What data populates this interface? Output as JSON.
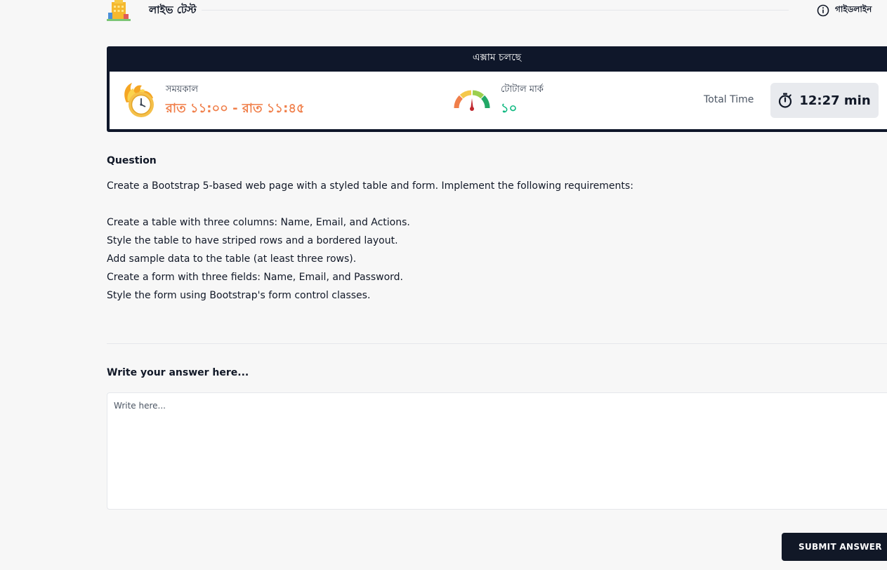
{
  "header": {
    "title": "লাইভ টেস্ট",
    "guideline_label": "গাইডলাইন",
    "logo_icon": "building-icon",
    "info_icon": "info-icon"
  },
  "exam": {
    "status": "এক্সাম চলছে",
    "duration_label": "সময়কাল",
    "duration_value": "রাত ১১:০০ - রাত ১১:৪৫",
    "marks_label": "টোটাল মার্ক",
    "marks_value": "১০",
    "total_time_label": "Total Time",
    "timer_value": "12:27 min",
    "colors": {
      "accent_orange": "#f07f4a",
      "accent_green": "#10b981",
      "dark": "#0f172a"
    }
  },
  "question": {
    "title": "Question",
    "lines": [
      "Create a Bootstrap 5-based web page with a styled table and form. Implement the following requirements:",
      "",
      "Create a table with three columns: Name, Email, and Actions.",
      "Style the table to have striped rows and a bordered layout.",
      "Add sample data to the table (at least three rows).",
      "Create a form with three fields: Name, Email, and Password.",
      "Style the form using Bootstrap's form control classes."
    ]
  },
  "answer": {
    "label": "Write your answer here...",
    "placeholder": "Write here...",
    "value": ""
  },
  "submit": {
    "label": "SUBMIT ANSWER"
  }
}
